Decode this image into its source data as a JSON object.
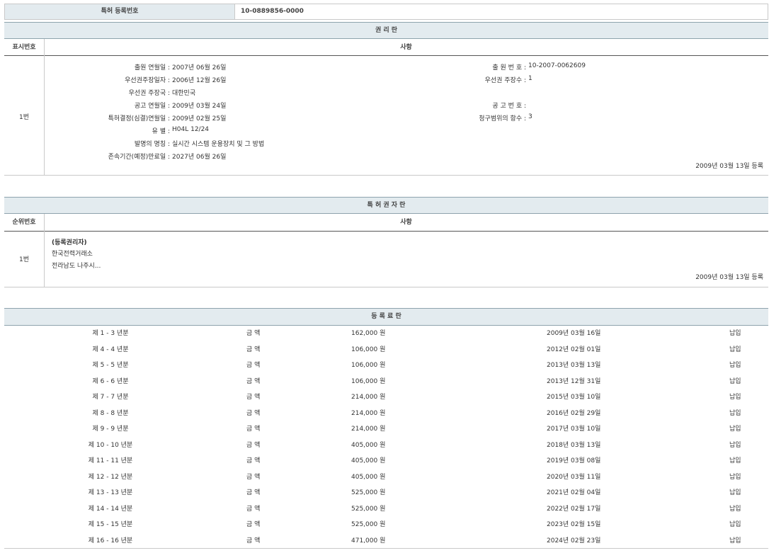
{
  "reg": {
    "label": "특허 등록번호",
    "value": "10-0889856-0000"
  },
  "rights": {
    "title": "권 리 란",
    "col_no": "표시번호",
    "col_item": "사항",
    "entry_no": "1번",
    "left": [
      {
        "label": "출원 연월일 :",
        "value": "2007년 06월 26일"
      },
      {
        "label": "우선권주장일자 :",
        "value": "2006년 12월 26일"
      },
      {
        "label": "우선권 주장국 :",
        "value": "대한민국"
      },
      {
        "label": "공고 연월일 :",
        "value": "2009년 03월 24일"
      },
      {
        "label": "특허결정(심결)연월일 :",
        "value": "2009년 02월 25일"
      },
      {
        "label": "유 별 :",
        "value": "H04L 12/24"
      },
      {
        "label": "발명의 명칭 :",
        "value": "실시간 시스템 운용장치 및 그 방법"
      },
      {
        "label": "존속기간(예정)만료일 :",
        "value": "2027년 06월 26일"
      }
    ],
    "right": [
      {
        "label": "출 원 번 호 :",
        "value": "10-2007-0062609"
      },
      {
        "label": "우선권 주장수 :",
        "value": "1"
      },
      {
        "label": "",
        "value": ""
      },
      {
        "label": "공 고 번 호 :",
        "value": ""
      },
      {
        "label": "청구범위의 항수 :",
        "value": "3"
      }
    ],
    "reg_date": "2009년 03월 13일 등록"
  },
  "owner": {
    "title": "특 허 권 자 란",
    "col_no": "순위번호",
    "col_item": "사항",
    "entry_no": "1번",
    "role": "(등록권리자)",
    "name": "한국전력거래소",
    "address": "전라남도 나주시...",
    "reg_date": "2009년 03월 13일 등록"
  },
  "fees": {
    "title": "등 록 료 란",
    "rows": [
      {
        "period": "제 1 - 3 년분",
        "label": "금 액",
        "amount": "162,000 원",
        "date": "2009년 03월 16일",
        "status": "납입"
      },
      {
        "period": "제 4 - 4 년분",
        "label": "금 액",
        "amount": "106,000 원",
        "date": "2012년 02월 01일",
        "status": "납입"
      },
      {
        "period": "제 5 - 5 년분",
        "label": "금 액",
        "amount": "106,000 원",
        "date": "2013년 03월 13일",
        "status": "납입"
      },
      {
        "period": "제 6 - 6 년분",
        "label": "금 액",
        "amount": "106,000 원",
        "date": "2013년 12월 31일",
        "status": "납입"
      },
      {
        "period": "제 7 - 7 년분",
        "label": "금 액",
        "amount": "214,000 원",
        "date": "2015년 03월 10일",
        "status": "납입"
      },
      {
        "period": "제 8 - 8 년분",
        "label": "금 액",
        "amount": "214,000 원",
        "date": "2016년 02월 29일",
        "status": "납입"
      },
      {
        "period": "제 9 - 9 년분",
        "label": "금 액",
        "amount": "214,000 원",
        "date": "2017년 03월 10일",
        "status": "납입"
      },
      {
        "period": "제 10 - 10 년분",
        "label": "금 액",
        "amount": "405,000 원",
        "date": "2018년 03월 13일",
        "status": "납입"
      },
      {
        "period": "제 11 - 11 년분",
        "label": "금 액",
        "amount": "405,000 원",
        "date": "2019년 03월 08일",
        "status": "납입"
      },
      {
        "period": "제 12 - 12 년분",
        "label": "금 액",
        "amount": "405,000 원",
        "date": "2020년 03월 11일",
        "status": "납입"
      },
      {
        "period": "제 13 - 13 년분",
        "label": "금 액",
        "amount": "525,000 원",
        "date": "2021년 02월 04일",
        "status": "납입"
      },
      {
        "period": "제 14 - 14 년분",
        "label": "금 액",
        "amount": "525,000 원",
        "date": "2022년 02월 17일",
        "status": "납입"
      },
      {
        "period": "제 15 - 15 년분",
        "label": "금 액",
        "amount": "525,000 원",
        "date": "2023년 02월 15일",
        "status": "납입"
      },
      {
        "period": "제 16 - 16 년분",
        "label": "금 액",
        "amount": "471,000 원",
        "date": "2024년 02월 23일",
        "status": "납입"
      }
    ]
  }
}
